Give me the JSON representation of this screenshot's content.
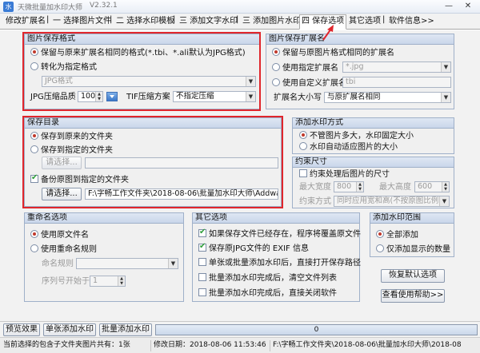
{
  "window": {
    "title": "天微批量加水印大师",
    "version": "V2.32.1",
    "minimize_glyph": "—",
    "close_glyph": "✕"
  },
  "tabs": [
    {
      "label": "修改扩展名",
      "active": false
    },
    {
      "label": "一  选择图片文件",
      "active": false
    },
    {
      "label": "二  选择水印模板",
      "active": false
    },
    {
      "label": "三  添加文字水印",
      "active": false
    },
    {
      "label": "三  添加图片水印",
      "active": false
    },
    {
      "label": "四  保存选项",
      "active": true
    },
    {
      "label": "其它选项",
      "active": false
    },
    {
      "label": "软件信息>>",
      "active": false
    }
  ],
  "tab_separator": "|",
  "image_format": {
    "title": "图片保存格式",
    "opt_keep": "保留与原来扩展名相同的格式(*.tbi、*.ali默认为JPG格式)",
    "opt_convert": "转化为指定格式",
    "format_value": "JPG格式",
    "jpg_quality_label": "JPG压缩品质",
    "jpg_quality_value": "100",
    "tif_label": "TIF压缩方案",
    "tif_value": "不指定压缩"
  },
  "ext_name": {
    "title": "图片保存扩展名",
    "opt_keep": "保留与原图片格式相同的扩展名",
    "opt_specified": "使用指定扩展名",
    "specified_value": "*.jpg",
    "opt_custom": "使用自定义扩展名",
    "custom_value": "tbi",
    "case_label": "扩展名大小写",
    "case_value": "与原扩展名相同"
  },
  "save_dir": {
    "title": "保存目录",
    "opt_original": "保存到原来的文件夹",
    "opt_specified": "保存到指定的文件夹",
    "choose_label": "请选择...",
    "backup_label": "备份原图到指定的文件夹",
    "backup_choose_label": "请选择...",
    "backup_path": "F:\\字畅工作文件夹\\2018-08-06\\批量加水印大师\\Addwa"
  },
  "watermark_mode": {
    "title": "添加水印方式",
    "opt_fixed": "不管图片多大，水印固定大小",
    "opt_auto": "水印自动适应图片的大小"
  },
  "size_limit": {
    "title": "约束尺寸",
    "constrain_label": "约束处理后图片的尺寸",
    "max_width_label": "最大宽度",
    "max_width_value": "800",
    "max_height_label": "最大高度",
    "max_height_value": "600",
    "mode_label": "约束方式",
    "mode_value": "同时应用宽和高(不按原图比例)"
  },
  "rename": {
    "title": "重命名选项",
    "opt_original": "使用原文件名",
    "opt_rule": "使用重命名规则",
    "rule_label": "命名规则",
    "start_label": "序列号开始于",
    "start_value": "1"
  },
  "other": {
    "title": "其它选项",
    "items": [
      {
        "label": "如果保存文件已经存在，程序将覆盖原文件",
        "checked": true
      },
      {
        "label": "保存原JPG文件的 EXIF 信息",
        "checked": true
      },
      {
        "label": "单张或批量添加水印后，直接打开保存路径",
        "checked": false
      },
      {
        "label": "批量添加水印完成后，清空文件列表",
        "checked": false
      },
      {
        "label": "批量添加水印完成后，直接关闭软件",
        "checked": false
      }
    ]
  },
  "range": {
    "title": "添加水印范围",
    "opt_all": "全部添加",
    "opt_shown": "仅添加显示的数量"
  },
  "buttons": {
    "restore_defaults": "恢复默认选项",
    "view_help": "查看使用帮助>>",
    "preview": "预览效果",
    "single_add": "单张添加水印",
    "batch_add": "批量添加水印"
  },
  "progress": {
    "value": 0,
    "text": "0"
  },
  "status": {
    "file_count": "当前选择的包含子文件夹图片共有：1张",
    "modified": "修改日期：2018-08-06 11:53:46",
    "path": "F:\\字畅工作文件夹\\2018-08-06\\批量加水印大师\\2018-08"
  },
  "colors": {
    "annotation_red": "#e0262c",
    "group_header": "#c9d6ea",
    "progress_fill": "#4caf50"
  }
}
